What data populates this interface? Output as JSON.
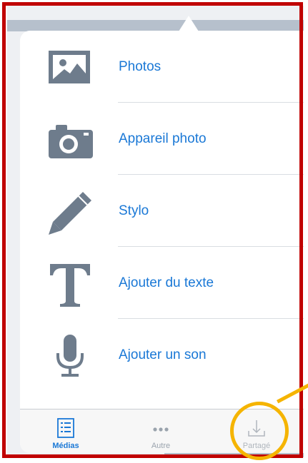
{
  "menu": {
    "items": [
      {
        "label": "Photos",
        "icon": "image-icon"
      },
      {
        "label": "Appareil photo",
        "icon": "camera-icon"
      },
      {
        "label": "Stylo",
        "icon": "pen-icon"
      },
      {
        "label": "Ajouter du texte",
        "icon": "text-icon"
      },
      {
        "label": "Ajouter un son",
        "icon": "microphone-icon"
      }
    ]
  },
  "tabbar": {
    "tabs": [
      {
        "label": "Médias",
        "icon": "list-icon",
        "active": true
      },
      {
        "label": "Autre",
        "icon": "ellipsis-icon",
        "active": false
      },
      {
        "label": "Partagé",
        "icon": "download-icon",
        "active": false
      }
    ]
  },
  "colors": {
    "accent": "#1a78d6",
    "icon_gray": "#6e7c8c",
    "frame_red": "#c00000",
    "highlight_yellow": "#f5b400"
  }
}
